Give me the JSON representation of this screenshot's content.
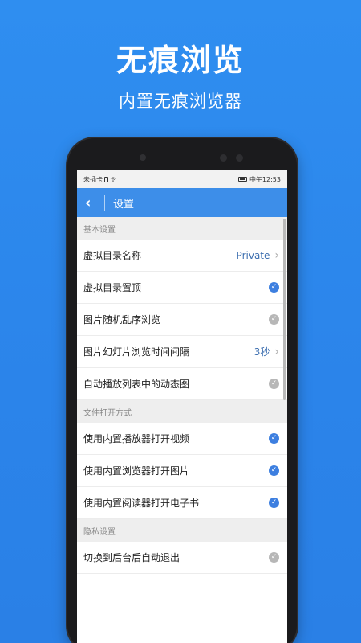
{
  "promo": {
    "headline": "无痕浏览",
    "subline": "内置无痕浏览器"
  },
  "status_bar": {
    "carrier": "未插卡",
    "time": "中午12:53"
  },
  "app_bar": {
    "back_icon": "‹",
    "title": "设置"
  },
  "sections": [
    {
      "title": "基本设置",
      "rows": [
        {
          "label": "虚拟目录名称",
          "value": "Private",
          "type": "nav"
        },
        {
          "label": "虚拟目录置顶",
          "checked": true,
          "type": "check"
        },
        {
          "label": "图片随机乱序浏览",
          "checked": false,
          "type": "check"
        },
        {
          "label": "图片幻灯片浏览时间间隔",
          "value": "3秒",
          "type": "nav"
        },
        {
          "label": "自动播放列表中的动态图",
          "checked": false,
          "type": "check"
        }
      ]
    },
    {
      "title": "文件打开方式",
      "rows": [
        {
          "label": "使用内置播放器打开视频",
          "checked": true,
          "type": "check"
        },
        {
          "label": "使用内置浏览器打开图片",
          "checked": true,
          "type": "check"
        },
        {
          "label": "使用内置阅读器打开电子书",
          "checked": true,
          "type": "check"
        }
      ]
    },
    {
      "title": "隐私设置",
      "rows": [
        {
          "label": "切换到后台后自动退出",
          "checked": false,
          "type": "check"
        }
      ]
    }
  ],
  "icons": {
    "check": "✓",
    "chevron": "›"
  },
  "colors": {
    "background": "#2f8ef0",
    "app_bar": "#3d8ee9",
    "check_on": "#3d7fe0",
    "check_off": "#b7b7b7"
  }
}
